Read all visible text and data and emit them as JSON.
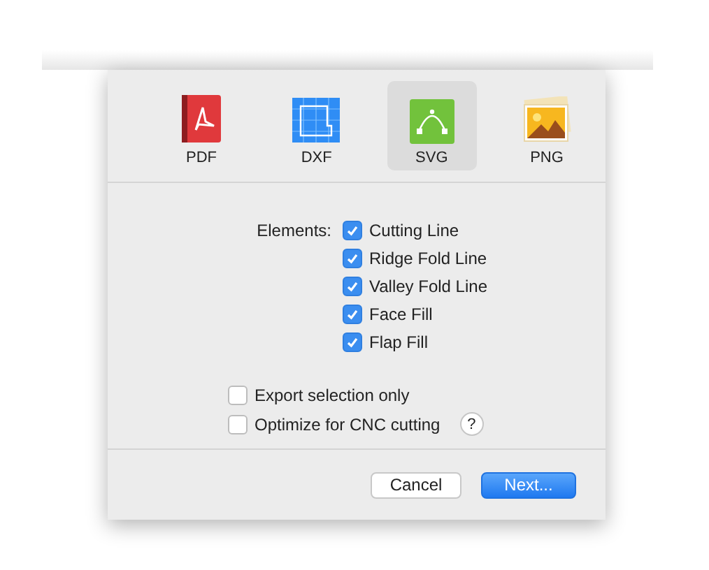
{
  "formats": [
    {
      "kind": "pdf",
      "label": "PDF",
      "selected": false
    },
    {
      "kind": "dxf",
      "label": "DXF",
      "selected": false
    },
    {
      "kind": "svg",
      "label": "SVG",
      "selected": true
    },
    {
      "kind": "png",
      "label": "PNG",
      "selected": false
    }
  ],
  "elements": {
    "label": "Elements:",
    "options": [
      {
        "label": "Cutting Line",
        "checked": true
      },
      {
        "label": "Ridge Fold Line",
        "checked": true
      },
      {
        "label": "Valley Fold Line",
        "checked": true
      },
      {
        "label": "Face Fill",
        "checked": true
      },
      {
        "label": "Flap Fill",
        "checked": true
      }
    ]
  },
  "options": [
    {
      "label": "Export selection only",
      "checked": false
    },
    {
      "label": "Optimize for CNC cutting",
      "checked": false,
      "help_label": "?"
    }
  ],
  "buttons": [
    {
      "label": "Cancel",
      "kind": "secondary"
    },
    {
      "label": "Next...",
      "kind": "primary"
    }
  ]
}
